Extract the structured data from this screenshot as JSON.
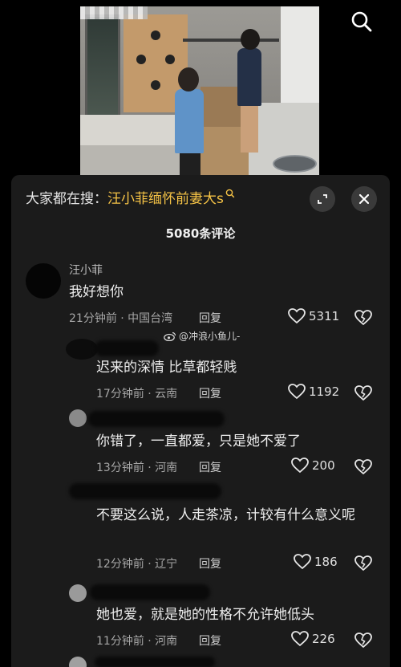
{
  "search_bar": {
    "prefix": "大家都在搜：",
    "query": "汪小菲缅怀前妻大s"
  },
  "comment_count": "5080条评论",
  "watermark": "@冲浪小鱼儿-",
  "reply_label": "回复",
  "comments": [
    {
      "author": "汪小菲",
      "text": "我好想你",
      "meta": "21分钟前 · 中国台湾",
      "likes": "5311"
    },
    {
      "author": "",
      "text": "迟来的深情  比草都轻贱",
      "meta": "17分钟前 · 云南",
      "likes": "1192"
    },
    {
      "author": "",
      "text": "你错了，一直都爱，只是她不爱了",
      "meta": "13分钟前 · 河南",
      "likes": "200"
    },
    {
      "author": "",
      "text": "不要这么说，人走茶凉，计较有什么意义呢",
      "meta": "12分钟前 · 辽宁",
      "likes": "186"
    },
    {
      "author": "",
      "text": "她也爱，就是她的性格不允许她低头",
      "meta": "11分钟前 · 河南",
      "likes": "226"
    }
  ],
  "colors": {
    "accent": "#f5c346",
    "panel_bg": "#1b1b1b"
  }
}
